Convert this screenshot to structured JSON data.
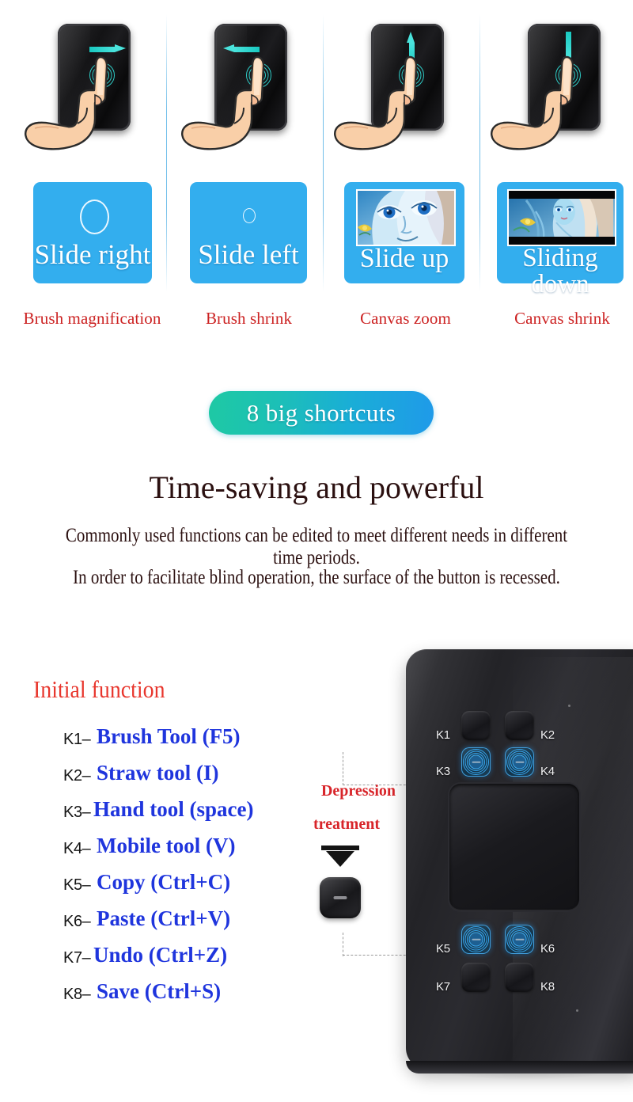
{
  "gestures": [
    {
      "direction": "right",
      "slide_label": "Slide right",
      "caption": "Brush magnification",
      "visual": "big-circle"
    },
    {
      "direction": "left",
      "slide_label": "Slide left",
      "caption": "Brush shrink",
      "visual": "small-circle"
    },
    {
      "direction": "up",
      "slide_label": "Slide up",
      "caption": "Canvas zoom",
      "visual": "artwork-zoomed-in"
    },
    {
      "direction": "down",
      "slide_label": "Sliding down",
      "caption": "Canvas shrink",
      "visual": "artwork-zoomed-out"
    }
  ],
  "badge": {
    "text": "8 big shortcuts"
  },
  "headline": "Time-saving and powerful",
  "sublines": [
    "Commonly used functions can be edited to meet different needs in different time periods.",
    "In order to facilitate blind operation, the surface of the button is recessed."
  ],
  "initial_function": {
    "title": "Initial function",
    "keys": [
      {
        "id": "K1–",
        "fn": "Brush Tool (F5)"
      },
      {
        "id": "K2–",
        "fn": "Straw tool (I)"
      },
      {
        "id": "K3–",
        "fn": "Hand tool (space)"
      },
      {
        "id": "K4–",
        "fn": "Mobile tool (V)"
      },
      {
        "id": "K5–",
        "fn": "Copy (Ctrl+C)"
      },
      {
        "id": "K6–",
        "fn": "Paste (Ctrl+V)"
      },
      {
        "id": "K7–",
        "fn": "Undo (Ctrl+Z)"
      },
      {
        "id": "K8–",
        "fn": "Save (Ctrl+S)"
      }
    ]
  },
  "callout": {
    "line1": "Depression",
    "line2": "treatment"
  },
  "device": {
    "buttons": [
      {
        "label": "K1",
        "glowing": false
      },
      {
        "label": "K2",
        "glowing": false
      },
      {
        "label": "K3",
        "glowing": true
      },
      {
        "label": "K4",
        "glowing": true
      },
      {
        "label": "K5",
        "glowing": true
      },
      {
        "label": "K6",
        "glowing": true
      },
      {
        "label": "K7",
        "glowing": false
      },
      {
        "label": "K8",
        "glowing": false
      }
    ]
  },
  "colors": {
    "panel_blue": "#33aeee",
    "caption_red": "#cc2222",
    "title_red": "#e8362d",
    "key_blue": "#1f35dd",
    "text_dark": "#2b1010",
    "badge_from": "#1ec9a4",
    "badge_to": "#1f9ae9",
    "arrow_cyan": "#2fd6d0",
    "led_blue": "#37a6ee"
  }
}
